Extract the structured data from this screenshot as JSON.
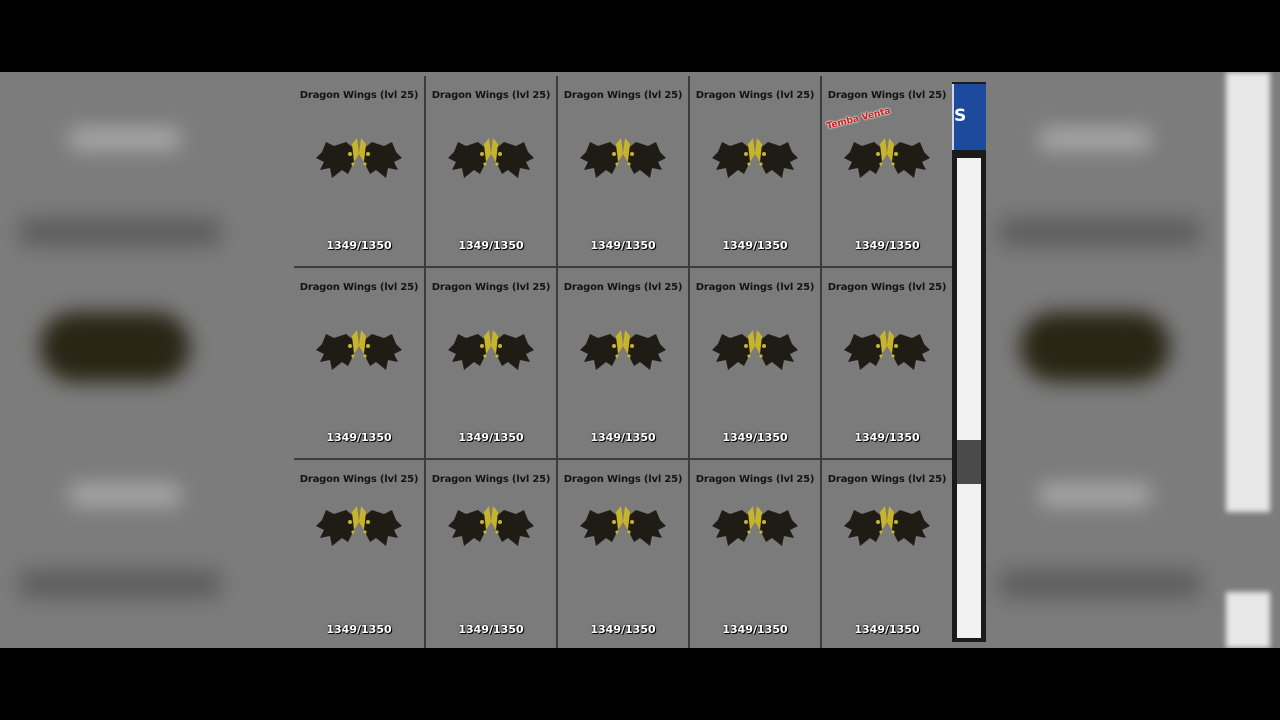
{
  "shop": {
    "side_button_label": "S",
    "items": [
      {
        "name": "Dragon Wings (lvl 25)",
        "stock": "1349/1350",
        "icon": "dragon-wings-icon"
      },
      {
        "name": "Dragon Wings (lvl 25)",
        "stock": "1349/1350",
        "icon": "dragon-wings-icon"
      },
      {
        "name": "Dragon Wings (lvl 25)",
        "stock": "1349/1350",
        "icon": "dragon-wings-icon"
      },
      {
        "name": "Dragon Wings (lvl 25)",
        "stock": "1349/1350",
        "icon": "dragon-wings-icon"
      },
      {
        "name": "Dragon Wings (lvl 25)",
        "stock": "1349/1350",
        "icon": "dragon-wings-icon",
        "badge": "Temba Venta"
      },
      {
        "name": "Dragon Wings (lvl 25)",
        "stock": "1349/1350",
        "icon": "dragon-wings-icon"
      },
      {
        "name": "Dragon Wings (lvl 25)",
        "stock": "1349/1350",
        "icon": "dragon-wings-icon"
      },
      {
        "name": "Dragon Wings (lvl 25)",
        "stock": "1349/1350",
        "icon": "dragon-wings-icon"
      },
      {
        "name": "Dragon Wings (lvl 25)",
        "stock": "1349/1350",
        "icon": "dragon-wings-icon"
      },
      {
        "name": "Dragon Wings (lvl 25)",
        "stock": "1349/1350",
        "icon": "dragon-wings-icon"
      },
      {
        "name": "Dragon Wings (lvl 25)",
        "stock": "1349/1350",
        "icon": "dragon-wings-icon"
      },
      {
        "name": "Dragon Wings (lvl 25)",
        "stock": "1349/1350",
        "icon": "dragon-wings-icon"
      },
      {
        "name": "Dragon Wings (lvl 25)",
        "stock": "1349/1350",
        "icon": "dragon-wings-icon"
      },
      {
        "name": "Dragon Wings (lvl 25)",
        "stock": "1349/1350",
        "icon": "dragon-wings-icon"
      },
      {
        "name": "Dragon Wings (lvl 25)",
        "stock": "1349/1350",
        "icon": "dragon-wings-icon"
      }
    ]
  },
  "colors": {
    "panel_bg": "#7b7b7b",
    "header_blue": "#1d4a9c",
    "wing_dark": "#1e1c14",
    "wing_gold": "#c8b42a",
    "badge_red": "#d21c1c"
  }
}
